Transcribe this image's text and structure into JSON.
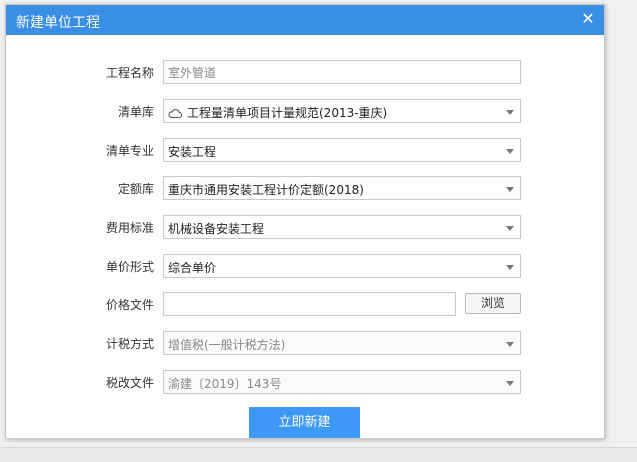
{
  "dialog": {
    "title": "新建单位工程",
    "close_glyph": "✕",
    "fields": {
      "project_name": {
        "label": "工程名称",
        "value": "室外管道"
      },
      "bill_library": {
        "label": "清单库",
        "value": "工程量清单项目计量规范(2013-重庆)",
        "icon": "cloud-icon"
      },
      "bill_specialty": {
        "label": "清单专业",
        "value": "安装工程"
      },
      "quota_library": {
        "label": "定额库",
        "value": "重庆市通用安装工程计价定额(2018)"
      },
      "fee_standard": {
        "label": "费用标准",
        "value": "机械设备安装工程"
      },
      "unit_price_form": {
        "label": "单价形式",
        "value": "综合单价"
      },
      "price_file": {
        "label": "价格文件",
        "value": "",
        "browse_label": "浏览"
      },
      "tax_method": {
        "label": "计税方式",
        "value": "增值税(一般计税方法)"
      },
      "tax_reform_file": {
        "label": "税改文件",
        "value": "渝建〔2019〕143号"
      }
    },
    "create_button": "立即新建"
  },
  "colors": {
    "titlebar": "#3a8ee6",
    "primary_button": "#3d99f5"
  }
}
